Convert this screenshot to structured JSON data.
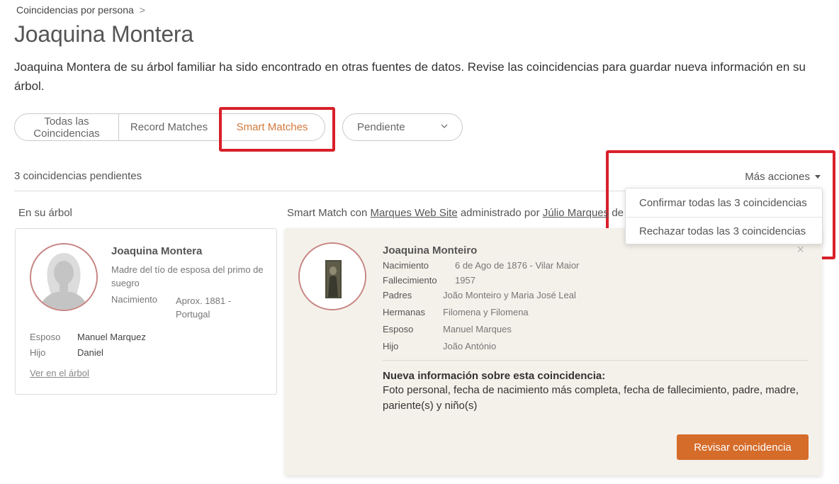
{
  "breadcrumb": {
    "label": "Coincidencias por persona",
    "separator": ">"
  },
  "page_title": "Joaquina Montera",
  "intro": "Joaquina Montera de su árbol familiar ha sido encontrado en otras fuentes de datos. Revise las coincidencias para guardar nueva información en su árbol.",
  "filters": {
    "tabs": [
      "Todas las Coincidencias",
      "Record Matches",
      "Smart Matches"
    ],
    "active_tab": "Smart Matches",
    "status_select": "Pendiente"
  },
  "pending_count": "3 coincidencias pendientes",
  "more_actions": {
    "label": "Más acciones",
    "items": [
      "Confirmar todas las 3 coincidencias",
      "Rechazar todas las 3 coincidencias"
    ]
  },
  "left_column": {
    "label": "En su árbol",
    "person": {
      "name": "Joaquina Montera",
      "relation": "Madre del tío de esposa del primo de suegro",
      "birth_label": "Nacimiento",
      "birth_value": "Aprox. 1881 - Portugal",
      "spouse_label": "Esposo",
      "spouse_value": "Manuel Marquez",
      "child_label": "Hijo",
      "child_value": "Daniel",
      "view_link": "Ver en el árbol"
    }
  },
  "right_column": {
    "label_prefix": "Smart Match con",
    "site": "Marques Web Site",
    "label_mid": "administrado por",
    "manager": "Júlio Marques",
    "label_suffix": "de",
    "match": {
      "name": "Joaquina Monteiro",
      "close": "×",
      "rows": [
        {
          "label": "Nacimiento",
          "value": "6 de Ago de 1876 - Vilar Maior"
        },
        {
          "label": "Fallecimiento",
          "value": "1957"
        },
        {
          "label": "Padres",
          "value": "João Monteiro y Maria José Leal"
        },
        {
          "label": "Hermanas",
          "value": "Filomena y Filomena"
        },
        {
          "label": "Esposo",
          "value": "Manuel Marques"
        },
        {
          "label": "Hijo",
          "value": "João António"
        }
      ],
      "new_info_title": "Nueva información sobre esta coincidencia:",
      "new_info_body": "Foto personal, fecha de nacimiento más completa, fecha de fallecimiento, padre, madre, pariente(s) y niño(s)",
      "review_button": "Revisar coincidencia"
    }
  },
  "colors": {
    "accent_orange": "#d56c2a",
    "highlight_red": "#d8202a",
    "avatar_ring": "#c78583",
    "match_card_bg": "#f4f1ea"
  },
  "icons": {
    "status_select": "chevron-down-icon",
    "more_actions": "caret-down-icon",
    "tree_avatar": "female-silhouette-icon",
    "match_photo": "person-photo-icon",
    "close": "close-icon"
  }
}
